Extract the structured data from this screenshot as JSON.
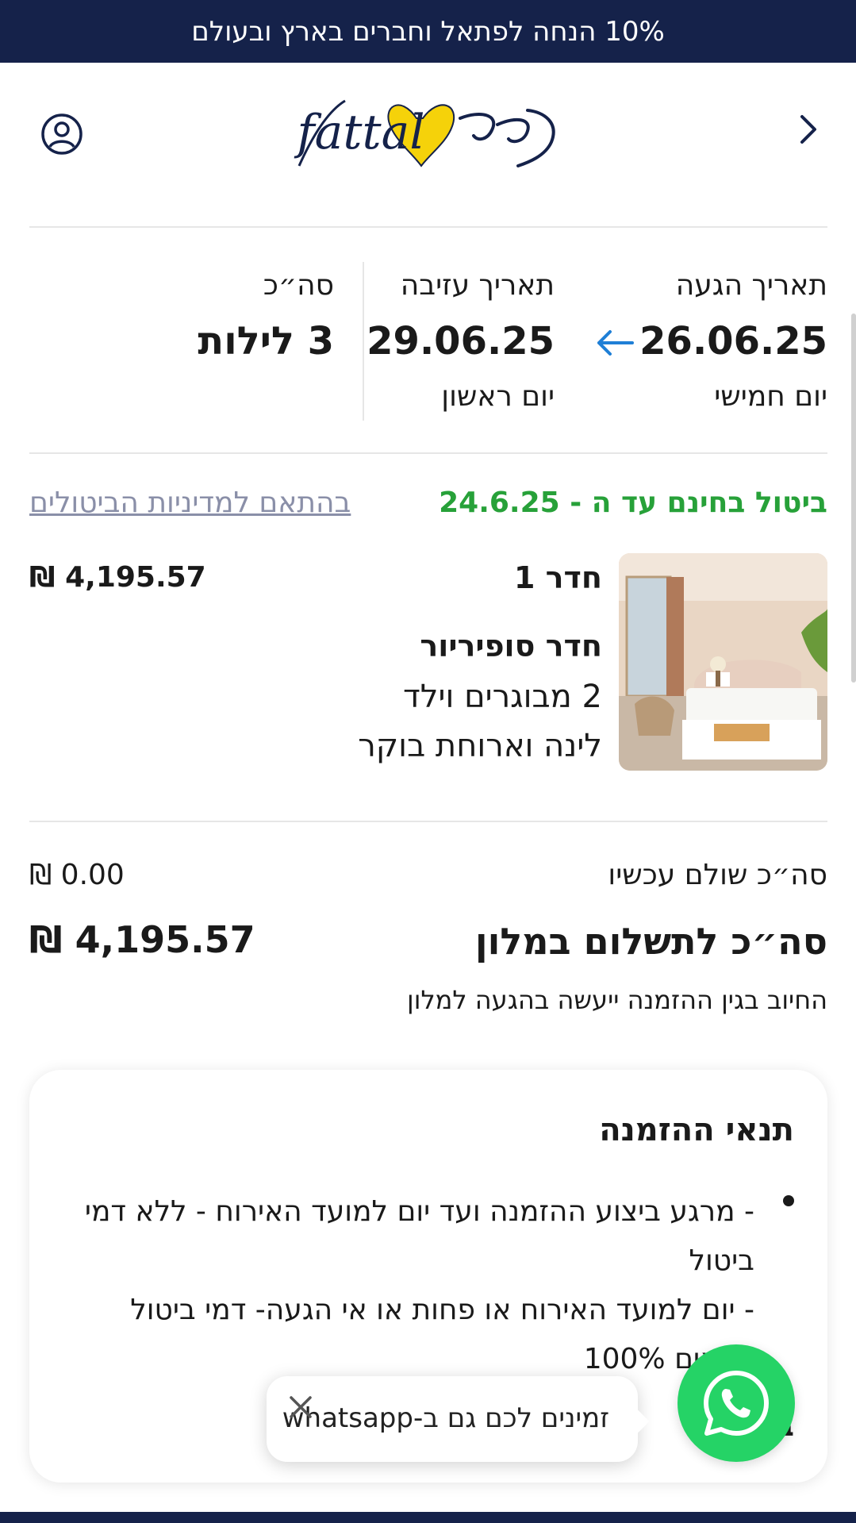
{
  "promo": {
    "text": "10% הנחה לפתאל וחברים בארץ ובעולם"
  },
  "header": {
    "back_icon": "chevron-right-icon",
    "logo_text": "fattal",
    "account_icon": "user-circle-icon"
  },
  "dates": {
    "arrival": {
      "label": "תאריך הגעה",
      "date": "26.06.25",
      "day": "יום חמישי"
    },
    "departure": {
      "label": "תאריך עזיבה",
      "date": "29.06.25",
      "day": "יום ראשון"
    },
    "total": {
      "label": "סה״כ",
      "value": "3 לילות"
    },
    "arrow_icon": "arrow-left-icon"
  },
  "cancellation": {
    "free_text": "ביטול בחינם עד ה - 24.6.25",
    "policy_link": "בהתאם למדיניות הביטולים"
  },
  "room": {
    "title": "חדר 1",
    "price": "₪ 4,195.57",
    "type": "חדר סופיריור",
    "guests": "2 מבוגרים וילד",
    "board": "לינה וארוחת בוקר"
  },
  "totals": {
    "paid_label": "סה״כ שולם עכשיו",
    "paid_value": "₪ 0.00",
    "hotel_label": "סה״כ לתשלום במלון",
    "hotel_value": "₪ 4,195.57",
    "hotel_note": "החיוב בגין ההזמנה ייעשה בהגעה למלון"
  },
  "terms": {
    "title": "תנאי ההזמנה",
    "line1": "- מרגע ביצוע ההזמנה ועד יום למועד האירוח - ללא דמי ביטול",
    "line2": "- יום למועד האירוח או פחות או אי הגעה- דמי ביטול מלאים 100%",
    "next_heading": "בח"
  },
  "whatsapp": {
    "bubble_text": "זמינים לכם גם ב-whatsapp",
    "close_icon": "close-icon",
    "button_icon": "whatsapp-icon",
    "color": "#25d366"
  },
  "colors": {
    "navy": "#15224a",
    "green": "#27a139",
    "link": "#8a8fa8",
    "accent_blue": "#1f7fd6",
    "logo_yellow": "#f5d20a"
  }
}
